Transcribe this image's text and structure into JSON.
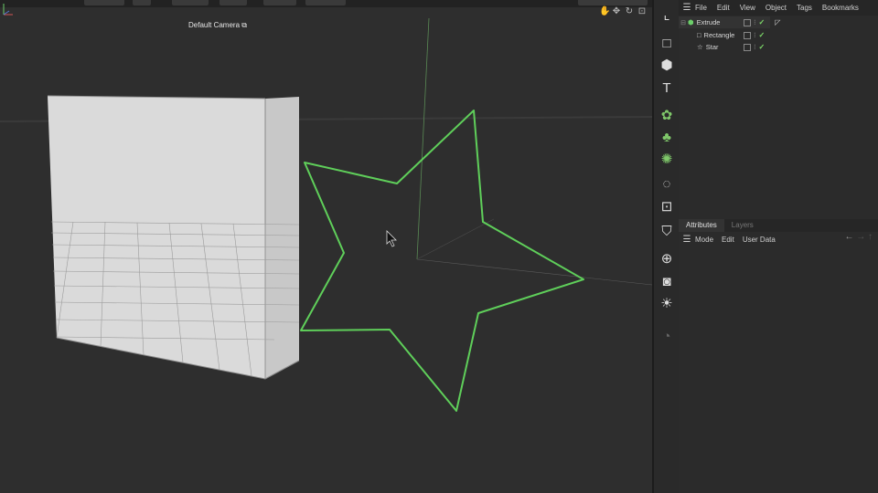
{
  "viewport": {
    "camera_label": "Default Camera",
    "camera_icon": "camera-options-icon",
    "view_icons": [
      "hand-pan-icon",
      "move-icon",
      "rotate-icon",
      "maximize-icon"
    ],
    "colors": {
      "background": "#2e2e2e",
      "star_spline": "#5fcf5a",
      "cube_face": "#dcdcdc"
    }
  },
  "palette": {
    "items": [
      {
        "name": "select-tool-icon",
        "glyph": "⌞"
      },
      {
        "name": "cube-primitive-icon",
        "glyph": "□"
      },
      {
        "name": "cube-object-icon",
        "glyph": "⬢"
      },
      {
        "name": "text-spline-icon",
        "glyph": "T"
      },
      {
        "name": "generator-icon",
        "glyph": "✿"
      },
      {
        "name": "cloner-icon",
        "glyph": "♣"
      },
      {
        "name": "deformer-icon",
        "glyph": "✺"
      },
      {
        "name": "field-icon",
        "glyph": "◌"
      },
      {
        "name": "effector-icon",
        "glyph": "⊡"
      },
      {
        "name": "mograph-icon",
        "glyph": "⛉"
      },
      {
        "name": "environment-icon",
        "glyph": "⊕"
      },
      {
        "name": "camera-icon",
        "glyph": "◙"
      },
      {
        "name": "light-icon",
        "glyph": "☀"
      },
      {
        "name": "render-icon",
        "glyph": "◔"
      }
    ]
  },
  "object_manager": {
    "menu": [
      "File",
      "Edit",
      "View",
      "Object",
      "Tags",
      "Bookmarks"
    ],
    "objects": [
      {
        "name": "Extrude",
        "icon": "extrude-icon"
      },
      {
        "name": "Rectangle",
        "icon": "rectangle-spline-icon"
      },
      {
        "name": "Star",
        "icon": "star-spline-icon"
      }
    ]
  },
  "attributes": {
    "tabs": [
      "Attributes",
      "Layers"
    ],
    "menu": [
      "Mode",
      "Edit",
      "User Data"
    ]
  }
}
